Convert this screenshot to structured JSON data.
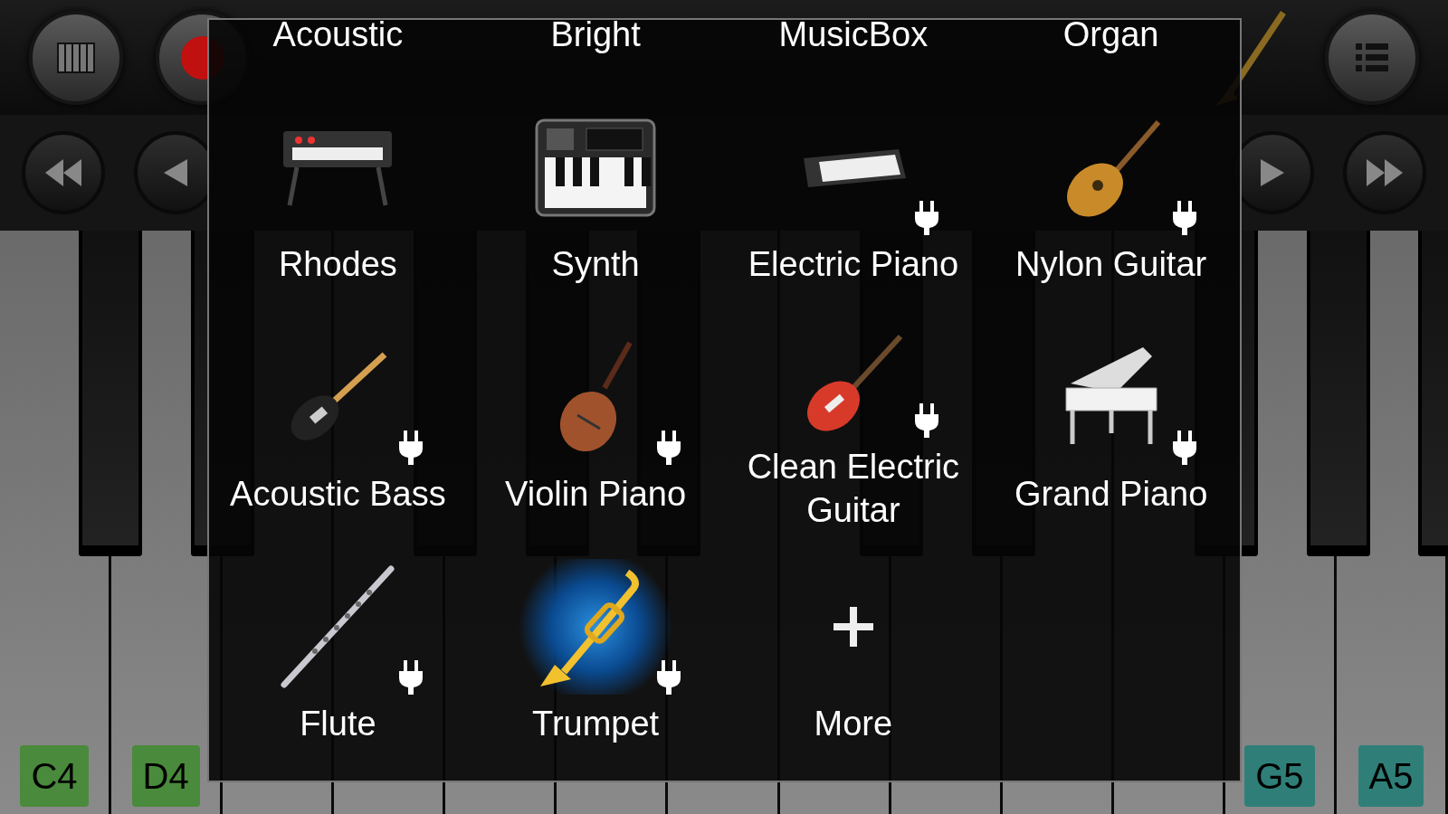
{
  "left_keys": [
    {
      "label": "C4",
      "color": "#4a8a3c"
    },
    {
      "label": "D4",
      "color": "#4a8a3c"
    }
  ],
  "right_keys": [
    {
      "label": "G5",
      "color": "#2f7f78"
    },
    {
      "label": "A5",
      "color": "#2f7f78"
    }
  ],
  "dialog": {
    "top_labels": [
      "Acoustic",
      "Bright",
      "MusicBox",
      "Organ"
    ],
    "items": [
      {
        "kind": "instrument",
        "label": "Rhodes",
        "plugin": false,
        "selected": false
      },
      {
        "kind": "instrument",
        "label": "Synth",
        "plugin": false,
        "selected": false
      },
      {
        "kind": "instrument",
        "label": "Electric Piano",
        "plugin": true,
        "selected": false
      },
      {
        "kind": "instrument",
        "label": "Nylon Guitar",
        "plugin": true,
        "selected": false
      },
      {
        "kind": "instrument",
        "label": "Acoustic Bass",
        "plugin": true,
        "selected": false
      },
      {
        "kind": "instrument",
        "label": "Violin Piano",
        "plugin": true,
        "selected": false
      },
      {
        "kind": "instrument",
        "label": "Clean Electric Guitar",
        "plugin": true,
        "selected": false
      },
      {
        "kind": "instrument",
        "label": "Grand Piano",
        "plugin": true,
        "selected": false
      },
      {
        "kind": "instrument",
        "label": "Flute",
        "plugin": true,
        "selected": false
      },
      {
        "kind": "instrument",
        "label": "Trumpet",
        "plugin": true,
        "selected": true
      },
      {
        "kind": "more",
        "label": "More",
        "plugin": false,
        "selected": false
      }
    ]
  }
}
